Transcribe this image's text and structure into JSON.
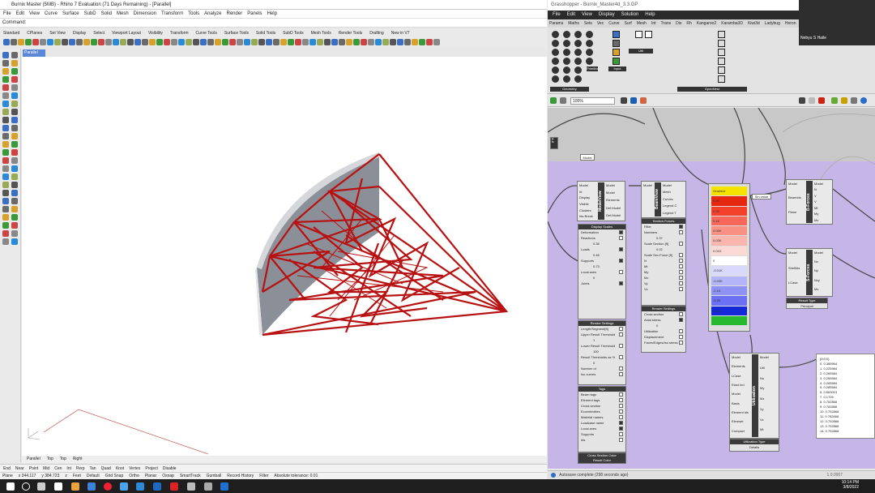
{
  "rhino": {
    "title": "Burnix Master (5MB) - Rhino 7 Evaluation (71 Days Remaining) - [Parallel]",
    "menu": [
      "File",
      "Edit",
      "View",
      "Curve",
      "Surface",
      "SubD",
      "Solid",
      "Mesh",
      "Dimension",
      "Transform",
      "Tools",
      "Analyze",
      "Render",
      "Panels",
      "Help"
    ],
    "command_label": "Command:",
    "toolbar_tabs": [
      "Standard",
      "CPlanes",
      "Set View",
      "Display",
      "Select",
      "Viewport Layout",
      "Visibility",
      "Transform",
      "Curve Tools",
      "Surface Tools",
      "Solid Tools",
      "SubD Tools",
      "Mesh Tools",
      "Render Tools",
      "Drafting",
      "New in V7"
    ],
    "viewport_label": "Parallel",
    "viewport_tabs": [
      "Parallel",
      "Top",
      "Top",
      "Right"
    ],
    "osnaps": [
      "End",
      "Near",
      "Point",
      "Mid",
      "Cen",
      "Int",
      "Perp",
      "Tan",
      "Quad",
      "Knot",
      "Vertex",
      "Project",
      "Disable"
    ],
    "status": [
      "Plane",
      "x 344.117",
      "y 384.723",
      "z",
      "Feet",
      "Default",
      "Grid Snap",
      "Ortho",
      "Planar",
      "Osnap",
      "SmartTrack",
      "Gumball",
      "Record History",
      "Filter",
      "Absolute tolerance: 0.01"
    ]
  },
  "grasshopper": {
    "title": "Grasshopper - Burnix_Master4d_3.3.GP",
    "menu": [
      "File",
      "Edit",
      "View",
      "Display",
      "Solution",
      "Help"
    ],
    "category_tabs": [
      "Params",
      "Maths",
      "Sets",
      "Vec",
      "Curve",
      "Surf",
      "Mesh",
      "Int",
      "Trans",
      "Dis",
      "Rh",
      "Kangaroo2",
      "Karamba3D",
      "Kiwi3d",
      "Ladybug",
      "Heron",
      "Sonic+",
      "Speckle",
      "Paneling",
      "Superfluous",
      "OpenNest Systems"
    ],
    "group_labels": [
      "Geometry",
      "Primitive",
      "Input",
      "Util",
      "OpenNest"
    ],
    "zoom": "100%",
    "status": "Autosave complete (298 seconds ago)",
    "version": "1.0.0007",
    "model_label": "Model",
    "cluster_label": "A-8",
    "model_view": {
      "name": "ModelView",
      "inputs": [
        "Model",
        "Id",
        "Display",
        "Visible",
        "Clusters",
        "Ids Break"
      ],
      "outputs": [
        "Model",
        "Model",
        "Elements",
        "Def.Model",
        "Def.Model"
      ]
    },
    "beam_view": {
      "name": "BeamView",
      "inputs": [
        "Model"
      ],
      "outputs": [
        "Model",
        "Mesh",
        "Curves",
        "Legend C",
        "Legend T"
      ]
    },
    "display_scales": {
      "title": "Display Scales",
      "items": [
        "Deformation",
        "Reactions",
        "Loads",
        "Supports",
        "Local axes",
        "Joints"
      ],
      "values": [
        "0.38",
        "0.48",
        "0.73",
        "0"
      ]
    },
    "render_settings": {
      "title": "Render Settings",
      "items": [
        "Length/Segment[ft]",
        "Upper Result Threshold",
        "Lower Result Threshold",
        "Result Thresholds as %",
        "Number of",
        "Iso curves"
      ],
      "values": [
        "1",
        "100",
        "0"
      ]
    },
    "tags": {
      "title": "Tags",
      "items": [
        "Beam tags",
        "Element tags",
        "Cross section",
        "Eccentricities",
        "Material names",
        "Loadcase name",
        "Local axes",
        "Supports",
        "Ids"
      ]
    },
    "cross_section_color": "Cross Section Color",
    "result_color": "Result Color",
    "section_forces": {
      "title": "Section Forces",
      "items": [
        "Filter",
        "Numbers",
        "Scale Section [ft]",
        "Scale Sec.Force [ft]",
        "N",
        "Mt",
        "My",
        "Mz",
        "Vy",
        "Vz"
      ],
      "values": [
        "0.37",
        "0.02"
      ]
    },
    "render_settings2": {
      "title": "Render Settings",
      "items": [
        "Cross section",
        "Axial stress",
        "Utilization",
        "Displacement",
        "Faces/Edges/Iso stress"
      ],
      "values": [
        "0"
      ]
    },
    "gradient_labels": [
      "Gradient",
      "0.4K",
      "0.2K",
      "0.1K",
      "0.05K",
      "0.03K",
      "0.01K",
      "0",
      "-0.01K",
      "-0.03K",
      "-0.1K",
      "-0.2K",
      "-0.4K"
    ],
    "gradient_colors": [
      "#f4e200",
      "#e62810",
      "#f3402a",
      "#f6685a",
      "#f89183",
      "#fab6ae",
      "#fbd9d4",
      "#ffffff",
      "#d8d9fb",
      "#b3b5f8",
      "#8f92f5",
      "#6c70f2",
      "#1428d8",
      "#28b830"
    ],
    "b_forces": {
      "name": "B-Forces",
      "inputs": [
        "Model",
        "BeamIds",
        "Plane"
      ],
      "outputs": [
        "Model",
        "N",
        "V",
        "V",
        "Mt",
        "My",
        "Mz"
      ]
    },
    "s_forces": {
      "name": "S-Forces",
      "inputs": [
        "Model",
        "ShellIds",
        "LCase"
      ],
      "outputs": [
        "Model",
        "Nx",
        "Ny",
        "Nxy",
        "Mx"
      ]
    },
    "result_type": {
      "title": "Result Type",
      "value": "Principal"
    },
    "utilization": {
      "name": "Utilization",
      "inputs": [
        "Model",
        "Elements",
        "LCase",
        "Elast Ind",
        "Model",
        "Basis",
        "Element ids",
        "Elemset",
        "Compact"
      ],
      "outputs": [
        "Model",
        "Util",
        "Nu",
        "My",
        "Mz",
        "Vy",
        "Vz",
        "Mt"
      ],
      "footer": "Utilization Type",
      "selected": "Details"
    },
    "sin_value": "Sin value",
    "values_panel": [
      "{0;0;0}",
      "0. 0.385964",
      "1. 0.225984",
      "2. 0.265584",
      "3. 0.265584",
      "4. 0.265584",
      "5. 0.285584",
      "6. 0.563013",
      "7. 0.1705",
      "8. 0.752868",
      "9. 0.752868",
      "10. 0.752868",
      "11. 0.752868",
      "12. 0.752868",
      "13. 0.752868",
      "14. 0.752868"
    ]
  },
  "webcam": {
    "name": "Nebyu S Haile"
  },
  "taskbar": {
    "time": "10:14 PM",
    "date": "3/8/2022"
  }
}
